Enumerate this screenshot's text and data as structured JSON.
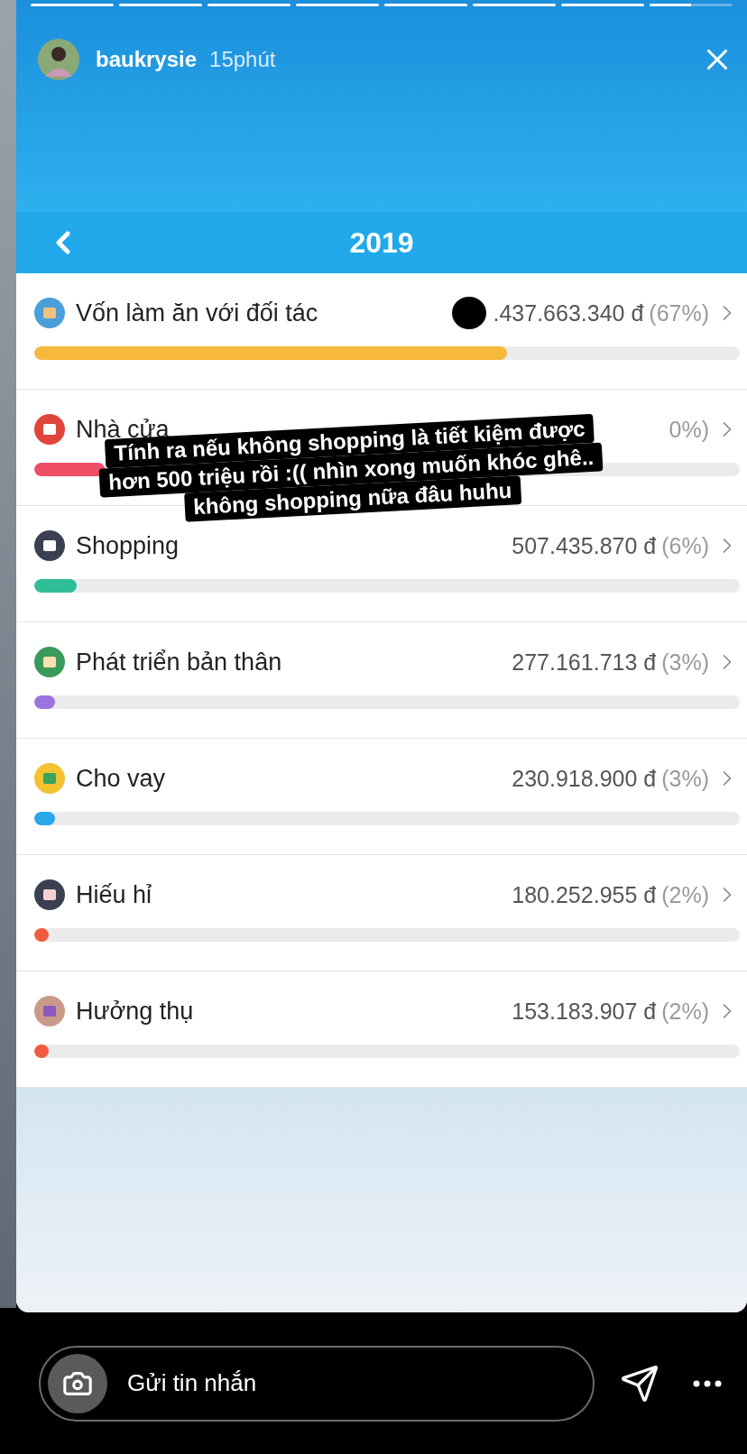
{
  "story": {
    "progress_segments": [
      {
        "level": 1
      },
      {
        "level": 1
      },
      {
        "level": 1
      },
      {
        "level": 1
      },
      {
        "level": 1
      },
      {
        "level": 1
      },
      {
        "level": 1
      },
      {
        "level": 0.5
      }
    ],
    "username": "baukrysie",
    "time": "15phút"
  },
  "header": {
    "title": "2019"
  },
  "categories": [
    {
      "name": "Vốn làm ăn với đối tác",
      "amount": ".437.663.340 đ",
      "percent": "(67%)",
      "level": 0.67,
      "color": "#f6b93b",
      "scribbled": true
    },
    {
      "name": "Nhà cửa",
      "percent": "0%)",
      "level": 0.1,
      "color": "#ee4d64",
      "scribbled": false
    },
    {
      "name": "Shopping",
      "amount": "507.435.870 đ",
      "percent": "(6%)",
      "level": 0.06,
      "color": "#2fbd98",
      "scribbled": false
    },
    {
      "name": "Phát triển bản thân",
      "amount": "277.161.713 đ",
      "percent": "(3%)",
      "level": 0.03,
      "color": "#9a74e0",
      "scribbled": false
    },
    {
      "name": "Cho vay",
      "amount": "230.918.900 đ",
      "percent": "(3%)",
      "level": 0.03,
      "color": "#2aa6ea",
      "scribbled": false
    },
    {
      "name": "Hiếu hỉ",
      "amount": "180.252.955 đ",
      "percent": "(2%)",
      "level": 0.02,
      "color": "#f05b3e",
      "scribbled": false
    },
    {
      "name": "Hưởng thụ",
      "amount": "153.183.907 đ",
      "percent": "(2%)",
      "level": 0.02,
      "color": "#f05b3e",
      "scribbled": false
    }
  ],
  "caption": [
    "Tính ra nếu không shopping là tiết kiệm được",
    "hơn 500 triệu rồi :(( nhìn xong muốn khóc ghê..",
    "không shopping nữa đâu huhu"
  ],
  "message_field": {
    "placeholder": "Gửi tin nhắn"
  }
}
